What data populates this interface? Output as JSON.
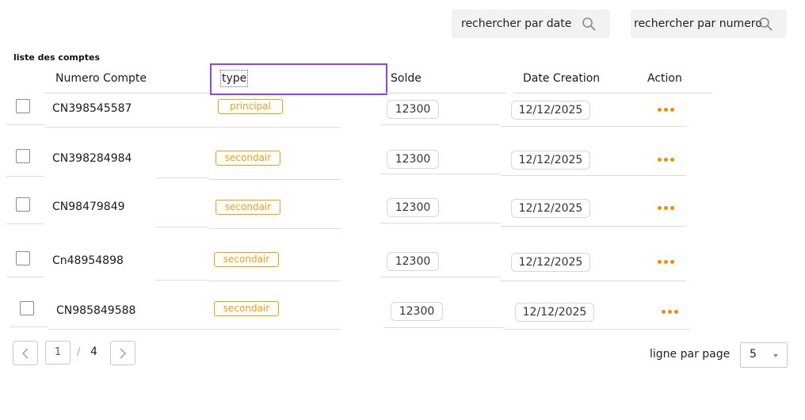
{
  "search": {
    "date_placeholder": "rechercher par date",
    "numero_placeholder": "rechercher par numero"
  },
  "list_title": "liste des comptes",
  "table": {
    "headers": {
      "numero": "Numero Compte",
      "type": "type",
      "solde": "Solde",
      "date": "Date Creation",
      "action": "Action"
    },
    "rows": [
      {
        "numero": "CN398545587",
        "type": "principal",
        "solde": "12300",
        "date": "12/12/2025"
      },
      {
        "numero": "CN398284984",
        "type": "secondair",
        "solde": "12300",
        "date": "12/12/2025"
      },
      {
        "numero": "CN98479849",
        "type": "secondair",
        "solde": "12300",
        "date": "12/12/2025"
      },
      {
        "numero": "Cn48954898",
        "type": "secondair",
        "solde": "12300",
        "date": "12/12/2025"
      },
      {
        "numero": "CN985849588",
        "type": "secondair",
        "solde": "12300",
        "date": "12/12/2025"
      }
    ]
  },
  "pagination": {
    "current_page": "1",
    "separator": "/",
    "total_pages": "4"
  },
  "rows_per_page": {
    "label": "ligne par page",
    "value": "5"
  },
  "colors": {
    "accent_orange": "#f08c00",
    "tag_orange": "#f59e0b",
    "focus_purple": "#8f46e0",
    "page_blue": "#3b5bd6"
  },
  "icons": [
    "search-icon",
    "chevron-left-icon",
    "chevron-right-icon",
    "more-dots-icon",
    "caret-down-icon"
  ]
}
